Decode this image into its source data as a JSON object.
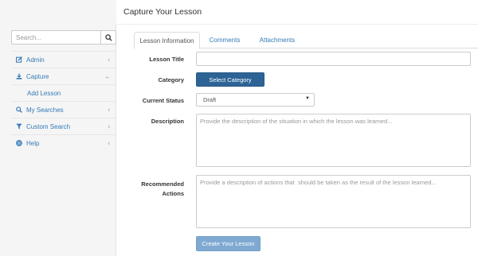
{
  "sidebar": {
    "search_placeholder": "Search...",
    "items": [
      {
        "label": "Admin",
        "icon": "edit-icon",
        "arrow": "‹"
      },
      {
        "label": "Capture",
        "icon": "download-icon",
        "arrow": "⌄"
      },
      {
        "label": "Add Lesson"
      },
      {
        "label": "My Searches",
        "icon": "search-icon",
        "arrow": "‹"
      },
      {
        "label": "Custom Search",
        "icon": "filter-icon",
        "arrow": "‹"
      },
      {
        "label": "Help",
        "icon": "lifebuoy-icon",
        "arrow": "‹"
      }
    ]
  },
  "page": {
    "title": "Capture Your Lesson"
  },
  "tabs": [
    {
      "label": "Lesson Information",
      "active": true
    },
    {
      "label": "Comments",
      "active": false
    },
    {
      "label": "Attachments",
      "active": false
    }
  ],
  "form": {
    "lesson_title_label": "Lesson Title",
    "lesson_title_value": "",
    "category_label": "Category",
    "category_button": "Select Category",
    "status_label": "Current Status",
    "status_value": "Draft",
    "description_label": "Description",
    "description_placeholder": "Provide the description of the situation in which the lesson was learned...",
    "actions_label_line1": "Recommended",
    "actions_label_line2": "Actions",
    "actions_placeholder": "Provide a description of actions that  should be taken as the result of the lesson learned...",
    "submit_button": "Create Your Lesson"
  },
  "colors": {
    "link": "#337ab7",
    "primary": "#2d6495",
    "submit_disabled": "#7fa9d1",
    "sidebar_bg": "#f5f5f5"
  }
}
